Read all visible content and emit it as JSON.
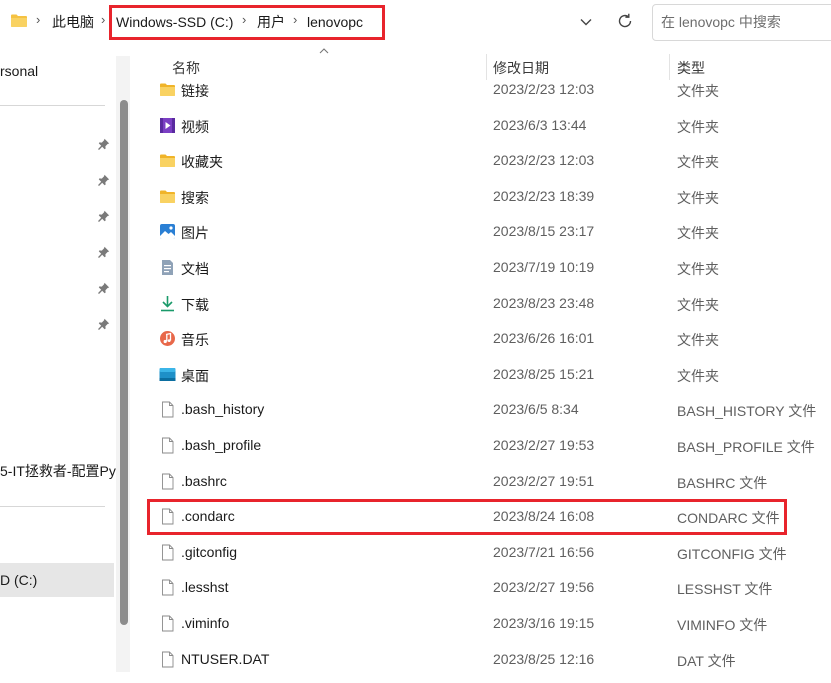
{
  "address_bar": {
    "root": "此电脑",
    "path": [
      "Windows-SSD (C:)",
      "用户",
      "lenovopc"
    ],
    "search_placeholder": "在 lenovopc 中搜索"
  },
  "nav": {
    "personal_label": "rsonal",
    "truncated_item": "5-IT拯救者-配置Py",
    "selected_drive": "D (C:)",
    "pinned_count": 6
  },
  "columns": {
    "name": "名称",
    "date": "修改日期",
    "type": "类型"
  },
  "files": [
    {
      "name": "链接",
      "date": "2023/2/23 12:03",
      "type": "文件夹",
      "icon": "folder-icon"
    },
    {
      "name": "视频",
      "date": "2023/6/3 13:44",
      "type": "文件夹",
      "icon": "video-folder-icon"
    },
    {
      "name": "收藏夹",
      "date": "2023/2/23 12:03",
      "type": "文件夹",
      "icon": "folder-icon"
    },
    {
      "name": "搜索",
      "date": "2023/2/23 18:39",
      "type": "文件夹",
      "icon": "folder-icon"
    },
    {
      "name": "图片",
      "date": "2023/8/15 23:17",
      "type": "文件夹",
      "icon": "pictures-folder-icon"
    },
    {
      "name": "文档",
      "date": "2023/7/19 10:19",
      "type": "文件夹",
      "icon": "documents-folder-icon"
    },
    {
      "name": "下载",
      "date": "2023/8/23 23:48",
      "type": "文件夹",
      "icon": "downloads-folder-icon"
    },
    {
      "name": "音乐",
      "date": "2023/6/26 16:01",
      "type": "文件夹",
      "icon": "music-folder-icon"
    },
    {
      "name": "桌面",
      "date": "2023/8/25 15:21",
      "type": "文件夹",
      "icon": "desktop-folder-icon"
    },
    {
      "name": ".bash_history",
      "date": "2023/6/5 8:34",
      "type": "BASH_HISTORY 文件",
      "icon": "file-icon"
    },
    {
      "name": ".bash_profile",
      "date": "2023/2/27 19:53",
      "type": "BASH_PROFILE 文件",
      "icon": "file-icon"
    },
    {
      "name": ".bashrc",
      "date": "2023/2/27 19:51",
      "type": "BASHRC 文件",
      "icon": "file-icon"
    },
    {
      "name": ".condarc",
      "date": "2023/8/24 16:08",
      "type": "CONDARC 文件",
      "icon": "file-icon"
    },
    {
      "name": ".gitconfig",
      "date": "2023/7/21 16:56",
      "type": "GITCONFIG 文件",
      "icon": "file-icon"
    },
    {
      "name": ".lesshst",
      "date": "2023/2/27 19:56",
      "type": "LESSHST 文件",
      "icon": "file-icon"
    },
    {
      "name": ".viminfo",
      "date": "2023/3/16 19:15",
      "type": "VIMINFO 文件",
      "icon": "file-icon"
    },
    {
      "name": "NTUSER.DAT",
      "date": "2023/8/25 12:16",
      "type": "DAT 文件",
      "icon": "file-icon"
    }
  ],
  "highlight_color": "#e8242c",
  "folder_color": "#f5c242"
}
